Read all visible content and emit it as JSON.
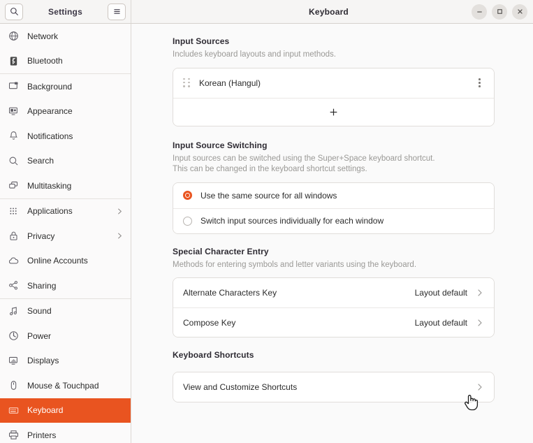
{
  "window": {
    "title": "Keyboard",
    "sidebar_title": "Settings",
    "controls": {
      "minimize": "–",
      "maximize": "□",
      "close": "✕"
    },
    "search_icon": "search-icon",
    "menu_icon": "hamburger-menu-icon"
  },
  "sidebar": {
    "items": [
      {
        "label": "Network",
        "icon": "globe-icon",
        "chevron": false,
        "selected": false,
        "sep_after": false
      },
      {
        "label": "Bluetooth",
        "icon": "bluetooth-icon",
        "chevron": false,
        "selected": false,
        "sep_after": true
      },
      {
        "label": "Background",
        "icon": "monitor-icon",
        "chevron": false,
        "selected": false,
        "sep_after": false
      },
      {
        "label": "Appearance",
        "icon": "appearance-icon",
        "chevron": false,
        "selected": false,
        "sep_after": false
      },
      {
        "label": "Notifications",
        "icon": "bell-icon",
        "chevron": false,
        "selected": false,
        "sep_after": false
      },
      {
        "label": "Search",
        "icon": "search-icon",
        "chevron": false,
        "selected": false,
        "sep_after": false
      },
      {
        "label": "Multitasking",
        "icon": "windows-icon",
        "chevron": false,
        "selected": false,
        "sep_after": true
      },
      {
        "label": "Applications",
        "icon": "grid-dots-icon",
        "chevron": true,
        "selected": false,
        "sep_after": false
      },
      {
        "label": "Privacy",
        "icon": "lock-icon",
        "chevron": true,
        "selected": false,
        "sep_after": false
      },
      {
        "label": "Online Accounts",
        "icon": "cloud-icon",
        "chevron": false,
        "selected": false,
        "sep_after": false
      },
      {
        "label": "Sharing",
        "icon": "share-icon",
        "chevron": false,
        "selected": false,
        "sep_after": true
      },
      {
        "label": "Sound",
        "icon": "music-note-icon",
        "chevron": false,
        "selected": false,
        "sep_after": false
      },
      {
        "label": "Power",
        "icon": "power-icon",
        "chevron": false,
        "selected": false,
        "sep_after": false
      },
      {
        "label": "Displays",
        "icon": "display-icon",
        "chevron": false,
        "selected": false,
        "sep_after": false
      },
      {
        "label": "Mouse & Touchpad",
        "icon": "mouse-icon",
        "chevron": false,
        "selected": false,
        "sep_after": false
      },
      {
        "label": "Keyboard",
        "icon": "keyboard-icon",
        "chevron": false,
        "selected": true,
        "sep_after": false
      },
      {
        "label": "Printers",
        "icon": "printer-icon",
        "chevron": false,
        "selected": false,
        "sep_after": false
      }
    ]
  },
  "main": {
    "input_sources": {
      "title": "Input Sources",
      "description": "Includes keyboard layouts and input methods.",
      "sources": [
        {
          "label": "Korean (Hangul)",
          "menu_icon": "overflow-menu-icon",
          "drag_icon": "drag-handle-icon"
        }
      ],
      "add_label": "+"
    },
    "input_source_switching": {
      "title": "Input Source Switching",
      "description_line1": "Input sources can be switched using the Super+Space keyboard shortcut.",
      "description_line2": "This can be changed in the keyboard shortcut settings.",
      "options": [
        {
          "label": "Use the same source for all windows",
          "selected": true
        },
        {
          "label": "Switch input sources individually for each window",
          "selected": false
        }
      ]
    },
    "special_character_entry": {
      "title": "Special Character Entry",
      "description": "Methods for entering symbols and letter variants using the keyboard.",
      "rows": [
        {
          "label": "Alternate Characters Key",
          "value": "Layout default"
        },
        {
          "label": "Compose Key",
          "value": "Layout default"
        }
      ]
    },
    "keyboard_shortcuts": {
      "title": "Keyboard Shortcuts",
      "rows": [
        {
          "label": "View and Customize Shortcuts",
          "value": ""
        }
      ]
    }
  },
  "colors": {
    "accent": "#e95420",
    "sidebar_bg": "#fbfafa",
    "content_bg": "#fafafa",
    "card_bg": "#ffffff"
  },
  "cursor": {
    "type": "pointing-hand-cursor"
  }
}
